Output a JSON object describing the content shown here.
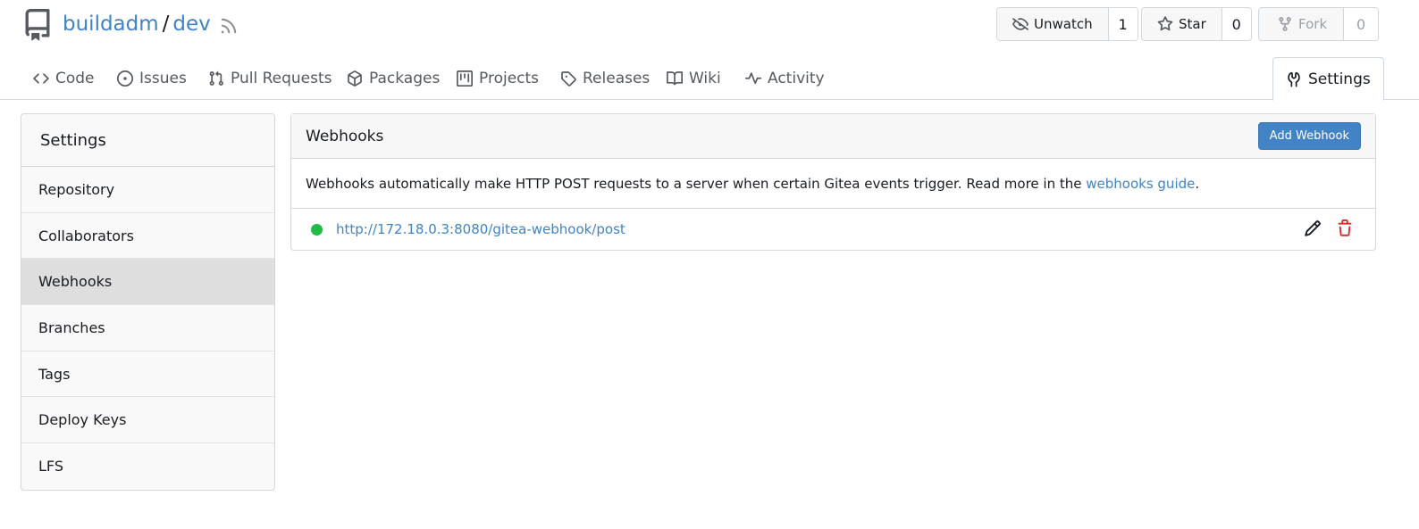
{
  "repo": {
    "owner": "buildadm",
    "separator": "/",
    "name": "dev"
  },
  "actions": {
    "unwatch": {
      "label": "Unwatch",
      "count": "1"
    },
    "star": {
      "label": "Star",
      "count": "0"
    },
    "fork": {
      "label": "Fork",
      "count": "0"
    }
  },
  "tabs": [
    {
      "label": "Code",
      "icon": "code-icon"
    },
    {
      "label": "Issues",
      "icon": "issue-icon"
    },
    {
      "label": "Pull Requests",
      "icon": "pull-request-icon"
    },
    {
      "label": "Packages",
      "icon": "package-icon"
    },
    {
      "label": "Projects",
      "icon": "project-icon"
    },
    {
      "label": "Releases",
      "icon": "tag-icon"
    },
    {
      "label": "Wiki",
      "icon": "book-icon"
    },
    {
      "label": "Activity",
      "icon": "pulse-icon"
    },
    {
      "label": "Settings",
      "icon": "tools-icon"
    }
  ],
  "sidebar": {
    "title": "Settings",
    "items": [
      {
        "label": "Repository"
      },
      {
        "label": "Collaborators"
      },
      {
        "label": "Webhooks"
      },
      {
        "label": "Branches"
      },
      {
        "label": "Tags"
      },
      {
        "label": "Deploy Keys"
      },
      {
        "label": "LFS"
      }
    ]
  },
  "webhooks": {
    "title": "Webhooks",
    "add_label": "Add Webhook",
    "desc_text": "Webhooks automatically make HTTP POST requests to a server when certain Gitea events trigger. Read more in the ",
    "desc_link": "webhooks guide",
    "desc_end": ".",
    "items": [
      {
        "url": "http://172.18.0.3:8080/gitea-webhook/post",
        "status": "active"
      }
    ]
  },
  "colors": {
    "link": "#4183c4",
    "active_dot": "#21ba45",
    "delete": "#db2828"
  }
}
